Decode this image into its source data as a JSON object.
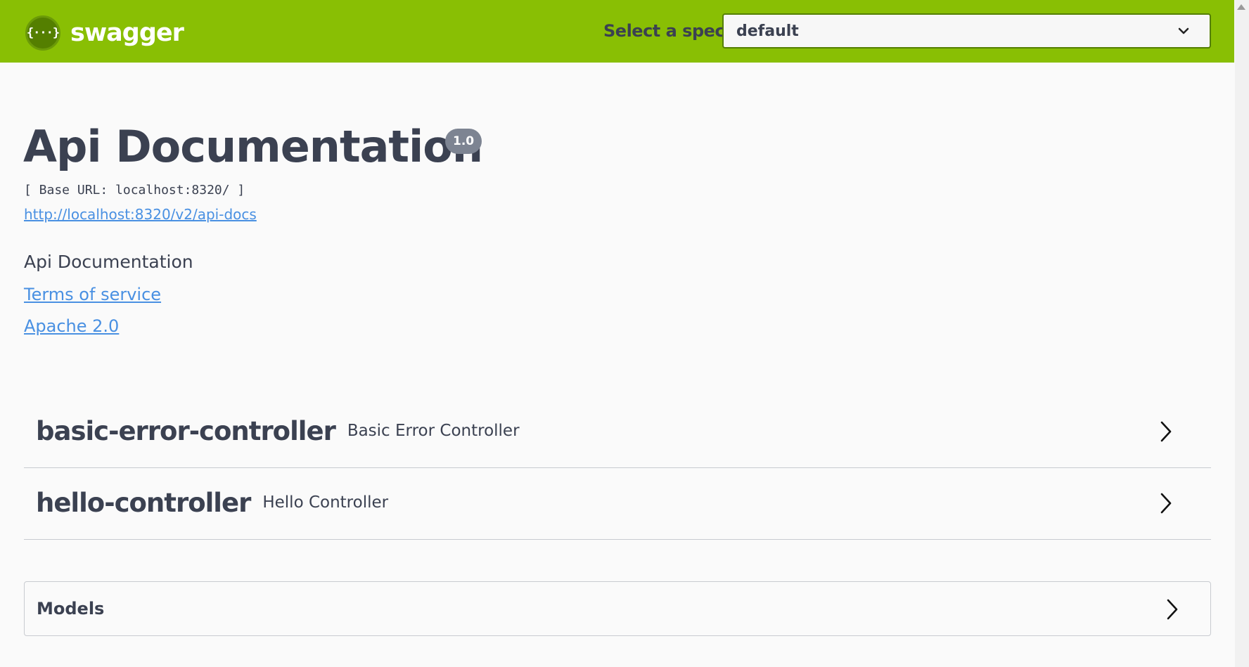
{
  "header": {
    "logo_badge": "{···}",
    "logo_text": "swagger",
    "spec_label": "Select a spec",
    "spec_selected": "default"
  },
  "info": {
    "title": "Api Documentation",
    "version": "1.0",
    "base_url": "[ Base URL: localhost:8320/ ]",
    "docs_link": "http://localhost:8320/v2/api-docs",
    "description": "Api Documentation",
    "terms_of_service": "Terms of service",
    "license": "Apache 2.0"
  },
  "tags": [
    {
      "name": "basic-error-controller",
      "description": "Basic Error Controller"
    },
    {
      "name": "hello-controller",
      "description": "Hello Controller"
    }
  ],
  "models": {
    "label": "Models"
  },
  "colors": {
    "topbar": "#89bf04",
    "text": "#3b4151",
    "link": "#4990e2",
    "badge": "#7d8492"
  }
}
